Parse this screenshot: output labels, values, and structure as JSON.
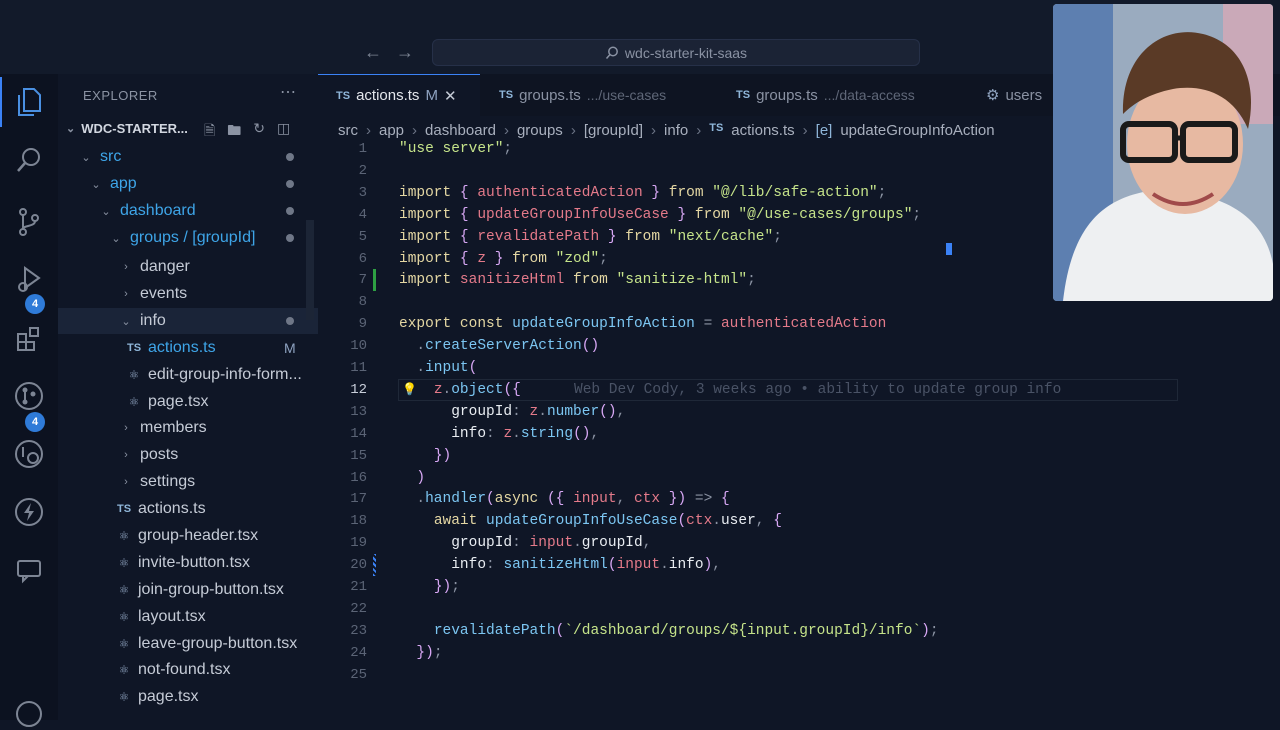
{
  "titlebar": {
    "search_text": "wdc-starter-kit-saas",
    "back_icon": "arrow-left-icon",
    "forward_icon": "arrow-right-icon"
  },
  "activity_bar": {
    "source_control_badge": "4",
    "extensions_badge": "4"
  },
  "explorer": {
    "title": "EXPLORER",
    "root": "WDC-STARTER...",
    "tree": [
      {
        "label": "src"
      },
      {
        "label": "app"
      },
      {
        "label": "dashboard"
      },
      {
        "label": "groups / [groupId]"
      },
      {
        "label": "danger"
      },
      {
        "label": "events"
      },
      {
        "label": "info"
      },
      {
        "label": "actions.ts",
        "badge": "M"
      },
      {
        "label": "edit-group-info-form..."
      },
      {
        "label": "page.tsx"
      },
      {
        "label": "members"
      },
      {
        "label": "posts"
      },
      {
        "label": "settings"
      },
      {
        "label": "actions.ts"
      },
      {
        "label": "group-header.tsx"
      },
      {
        "label": "invite-button.tsx"
      },
      {
        "label": "join-group-button.tsx"
      },
      {
        "label": "layout.tsx"
      },
      {
        "label": "leave-group-button.tsx"
      },
      {
        "label": "not-found.tsx"
      },
      {
        "label": "page.tsx"
      }
    ]
  },
  "tabs": [
    {
      "icon": "TS",
      "label": "actions.ts",
      "status": "M"
    },
    {
      "icon": "TS",
      "label": "groups.ts",
      "path": ".../use-cases"
    },
    {
      "icon": "TS",
      "label": "groups.ts",
      "path": ".../data-access"
    },
    {
      "label": "users"
    }
  ],
  "breadcrumb": [
    "src",
    "app",
    "dashboard",
    "groups",
    "[groupId]",
    "info",
    "actions.ts",
    "updateGroupInfoAction"
  ],
  "editor": {
    "current_line": "12",
    "blame": "Web Dev Cody, 3 weeks ago • ability to update group info",
    "lines": [
      {
        "n": "1",
        "text": "\"use server\";"
      },
      {
        "n": "2",
        "text": ""
      },
      {
        "n": "3",
        "text": "import { authenticatedAction } from \"@/lib/safe-action\";"
      },
      {
        "n": "4",
        "text": "import { updateGroupInfoUseCase } from \"@/use-cases/groups\";"
      },
      {
        "n": "5",
        "text": "import { revalidatePath } from \"next/cache\";"
      },
      {
        "n": "6",
        "text": "import { z } from \"zod\";"
      },
      {
        "n": "7",
        "text": "import sanitizeHtml from \"sanitize-html\";"
      },
      {
        "n": "8",
        "text": ""
      },
      {
        "n": "9",
        "text": "export const updateGroupInfoAction = authenticatedAction"
      },
      {
        "n": "10",
        "text": "  .createServerAction()"
      },
      {
        "n": "11",
        "text": "  .input("
      },
      {
        "n": "12",
        "text": "    z.object({"
      },
      {
        "n": "13",
        "text": "      groupId: z.number(),"
      },
      {
        "n": "14",
        "text": "      info: z.string(),"
      },
      {
        "n": "15",
        "text": "    })"
      },
      {
        "n": "16",
        "text": "  )"
      },
      {
        "n": "17",
        "text": "  .handler(async ({ input, ctx }) => {"
      },
      {
        "n": "18",
        "text": "    await updateGroupInfoUseCase(ctx.user, {"
      },
      {
        "n": "19",
        "text": "      groupId: input.groupId,"
      },
      {
        "n": "20",
        "text": "      info: sanitizeHtml(input.info),"
      },
      {
        "n": "21",
        "text": "    });"
      },
      {
        "n": "22",
        "text": ""
      },
      {
        "n": "23",
        "text": "    revalidatePath(`/dashboard/groups/${input.groupId}/info`);"
      },
      {
        "n": "24",
        "text": "  });"
      },
      {
        "n": "25",
        "text": ""
      }
    ]
  },
  "colors": {
    "accent": "#3b82f6",
    "badge": "#2f7bd8",
    "modified_folder": "#3ea5e8",
    "added_line": "#2ea043"
  }
}
